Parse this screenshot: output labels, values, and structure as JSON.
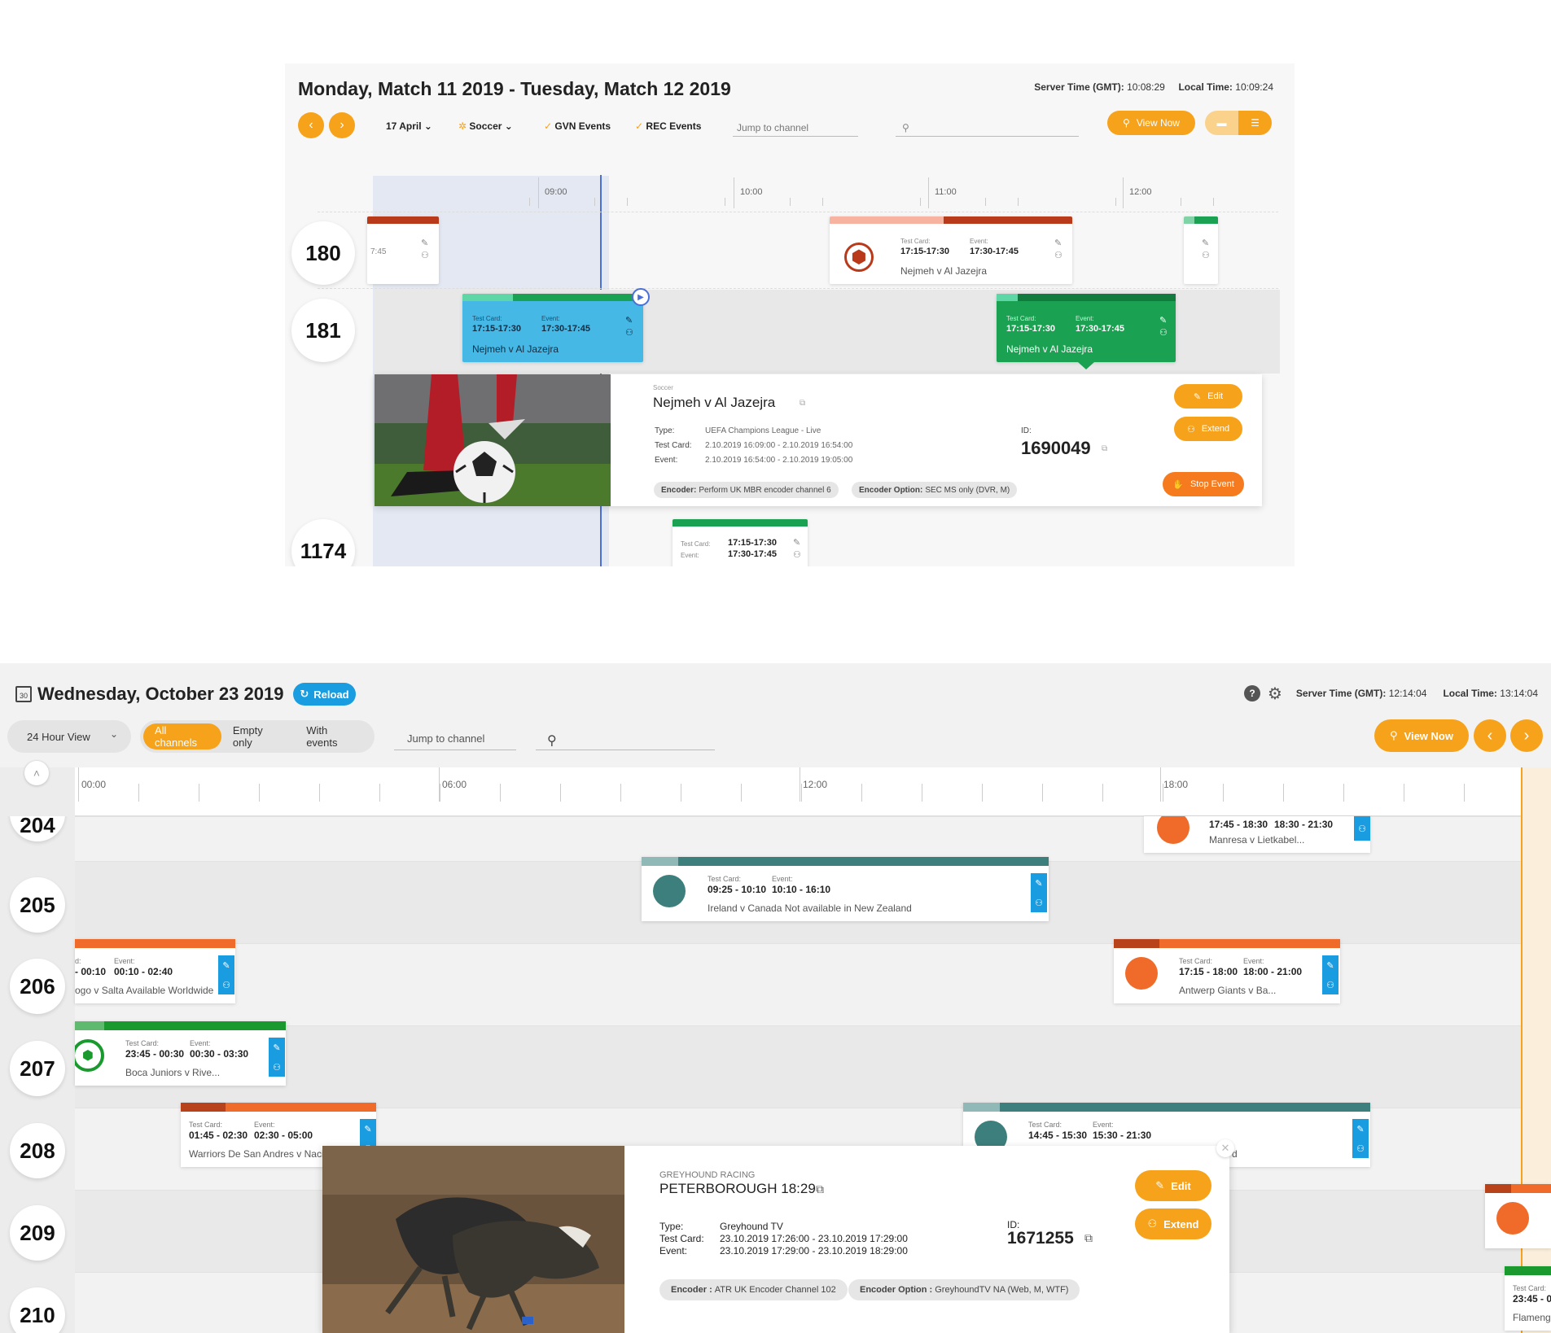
{
  "panel1": {
    "title": "Monday, Match 11 2019 - Tuesday, Match 12 2019",
    "server_time_label": "Server Time (GMT):",
    "server_time": "10:08:29",
    "local_time_label": "Local Time:",
    "local_time": "10:09:24",
    "prev_icon": "chevron-left-icon",
    "next_icon": "chevron-right-icon",
    "date_filter": "17 April",
    "sport_filter": "Soccer",
    "gvn_events": "GVN Events",
    "rec_events": "REC Events",
    "jump_placeholder": "Jump to channel",
    "view_now": "View Now",
    "ticks": [
      "09:00",
      "10:00",
      "11:00",
      "12:00"
    ],
    "channels": [
      "180",
      "181",
      "1174"
    ],
    "events": [
      {
        "partial_time": "7:45"
      },
      {
        "test_card_label": "Test Card:",
        "test_card": "17:15-17:30",
        "event_label": "Event:",
        "event": "17:30-17:45",
        "name": "Nejmeh v Al Jazejra"
      },
      {
        "test_card_label": "Test Card:",
        "test_card": "17:15-17:30",
        "event_label": "Event:",
        "event": "17:30-17:45",
        "name": "Nejmeh v Al Jazejra"
      },
      {
        "test_card_label": "Test Card:",
        "test_card": "17:15-17:30",
        "event_label": "Event:",
        "event": "17:30-17:45",
        "name": "Nejmeh v Al Jazejra"
      },
      {
        "test_card_label": "Test Card:",
        "test_card": "17:15-17:30",
        "event_label": "Event:",
        "event": "17:30-17:45"
      }
    ],
    "detail": {
      "sport": "Soccer",
      "name": "Nejmeh v Al Jazejra",
      "type_label": "Type:",
      "type": "UEFA Champions League - Live",
      "test_card_label": "Test Card:",
      "test_card": "2.10.2019 16:09:00 - 2.10.2019 16:54:00",
      "event_label": "Event:",
      "event": "2.10.2019 16:54:00 - 2.10.2019 19:05:00",
      "id_label": "ID:",
      "id": "1690049",
      "encoder_label": "Encoder:",
      "encoder": "Perform UK MBR encoder channel 6",
      "encoder_option_label": "Encoder Option:",
      "encoder_option": "SEC MS only (DVR, M)",
      "edit": "Edit",
      "extend": "Extend",
      "stop": "Stop Event"
    }
  },
  "panel2": {
    "title": "Wednesday, October 23 2019",
    "calendar_day": "30",
    "reload": "Reload",
    "server_time_label": "Server Time (GMT):",
    "server_time": "12:14:04",
    "local_time_label": "Local Time:",
    "local_time": "13:14:04",
    "view_select": "24 Hour View",
    "filters": [
      "All channels",
      "Empty only",
      "With events"
    ],
    "jump_placeholder": "Jump to channel",
    "view_now": "View Now",
    "ticks": [
      "00:00",
      "06:00",
      "12:00",
      "18:00"
    ],
    "channels": [
      "204",
      "205",
      "206",
      "207",
      "208",
      "209",
      "210"
    ],
    "events": [
      {
        "test_card": "17:45 - 18:30",
        "event": "18:30 - 21:30",
        "name": "Manresa v Lietkabel..."
      },
      {
        "test_card_label": "Test Card:",
        "test_card": "09:25 - 10:10",
        "event_label": "Event:",
        "event": "10:10 - 16:10",
        "name": "Ireland v Canada Not available in New Zealand"
      },
      {
        "test_card_label": "d:",
        "test_card": "- 00:10",
        "event_label": "Event:",
        "event": "00:10 - 02:40",
        "name": "ogo v Salta Available Worldwide"
      },
      {
        "test_card_label": "Test Card:",
        "test_card": "17:15 - 18:00",
        "event_label": "Event:",
        "event": "18:00 - 21:00",
        "name": "Antwerp Giants v Ba..."
      },
      {
        "test_card_label": "Test Card:",
        "test_card": "23:45 - 00:30",
        "event_label": "Event:",
        "event": "00:30 - 03:30",
        "name": "Boca Juniors v Rive..."
      },
      {
        "test_card_label": "Test Card:",
        "test_card": "01:45 - 02:30",
        "event_label": "Event:",
        "event": "02:30 - 05:00",
        "name": "Warriors De San Andres v Naci"
      },
      {
        "test_card_label": "Test Card:",
        "test_card": "14:45 - 15:30",
        "event_label": "Event:",
        "event": "15:30 - 21:30",
        "name": "d"
      },
      {
        "test_card_label": "Test Card:",
        "test_card": "23:45 - 0",
        "name": "Flameng"
      }
    ],
    "detail": {
      "sport": "GREYHOUND RACING",
      "name": "PETERBOROUGH 18:29",
      "type_label": "Type:",
      "type": "Greyhound TV",
      "test_card_label": "Test Card:",
      "test_card": "23.10.2019 17:26:00 - 23.10.2019 17:29:00",
      "event_label": "Event:",
      "event": "23.10.2019 17:29:00 - 23.10.2019 18:29:00",
      "id_label": "ID:",
      "id": "1671255",
      "encoder_label": "Encoder :",
      "encoder": "ATR UK Encoder Channel 102",
      "encoder_option_label": "Encoder Option :",
      "encoder_option": "GreyhoundTV NA (Web, M, WTF)",
      "edit": "Edit",
      "extend": "Extend"
    }
  },
  "colors": {
    "accent_orange": "#f7a21b",
    "blue": "#1a9ce0",
    "green": "#1aa152",
    "teal": "#3c7f7c",
    "basketball_orange": "#f06a2a"
  }
}
